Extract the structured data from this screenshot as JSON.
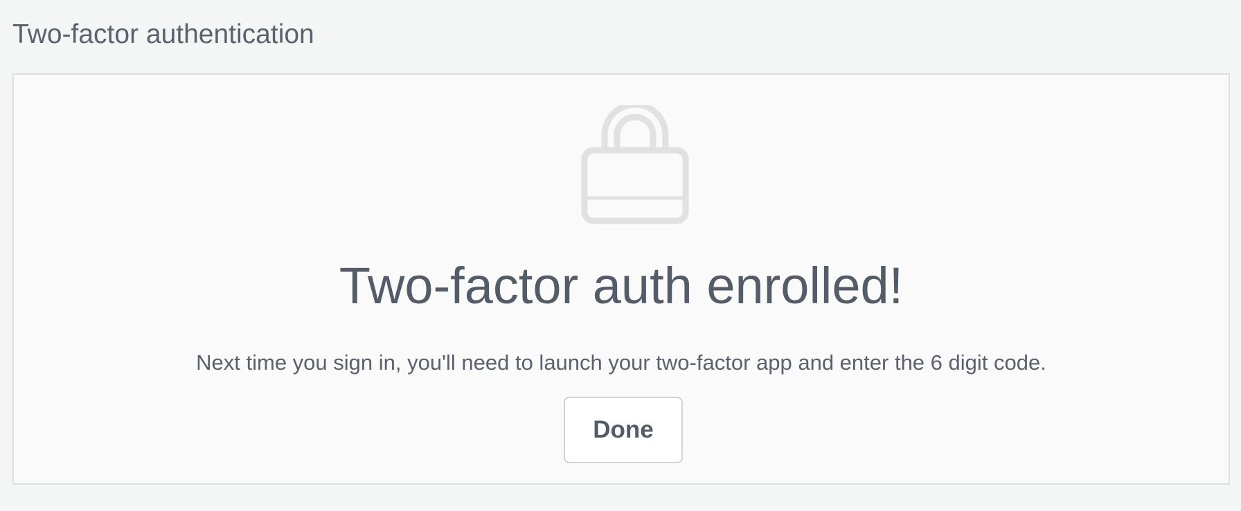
{
  "header": {
    "title": "Two-factor authentication"
  },
  "panel": {
    "icon": "lock-icon",
    "headline": "Two-factor auth enrolled!",
    "description": "Next time you sign in, you'll need to launch your two-factor app and enter the 6 digit code.",
    "done_label": "Done"
  },
  "colors": {
    "page_background": "#f4f5f5",
    "panel_background": "#fafafa",
    "text": "#525a66",
    "icon": "#e1e1e1",
    "border": "#dcdfe1"
  }
}
